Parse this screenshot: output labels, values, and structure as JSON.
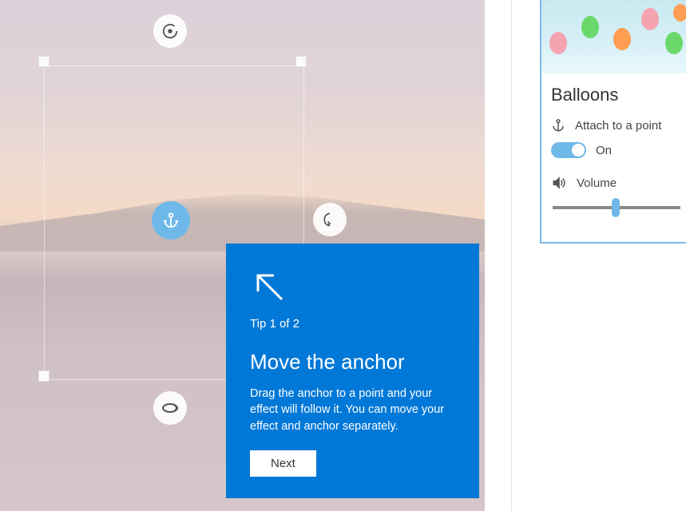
{
  "tip": {
    "counter": "Tip 1 of 2",
    "title": "Move the anchor",
    "body": "Drag the anchor to a point and your effect will follow it. You can move your effect and anchor separately.",
    "next_label": "Next"
  },
  "effect": {
    "name": "Balloons",
    "attach_label": "Attach to a point",
    "toggle_state": "On",
    "volume_label": "Volume",
    "volume_value": 46
  },
  "icons": {
    "anchor": "anchor-icon",
    "rotate_top": "rotate-cw-icon",
    "rotate_right": "rotate-vertical-icon",
    "rotate_bottom": "rotate-horizontal-icon",
    "arrow": "arrow-up-left-icon",
    "volume": "volume-icon"
  },
  "colors": {
    "accent": "#0078d7",
    "toggle": "#6fb9e8"
  }
}
